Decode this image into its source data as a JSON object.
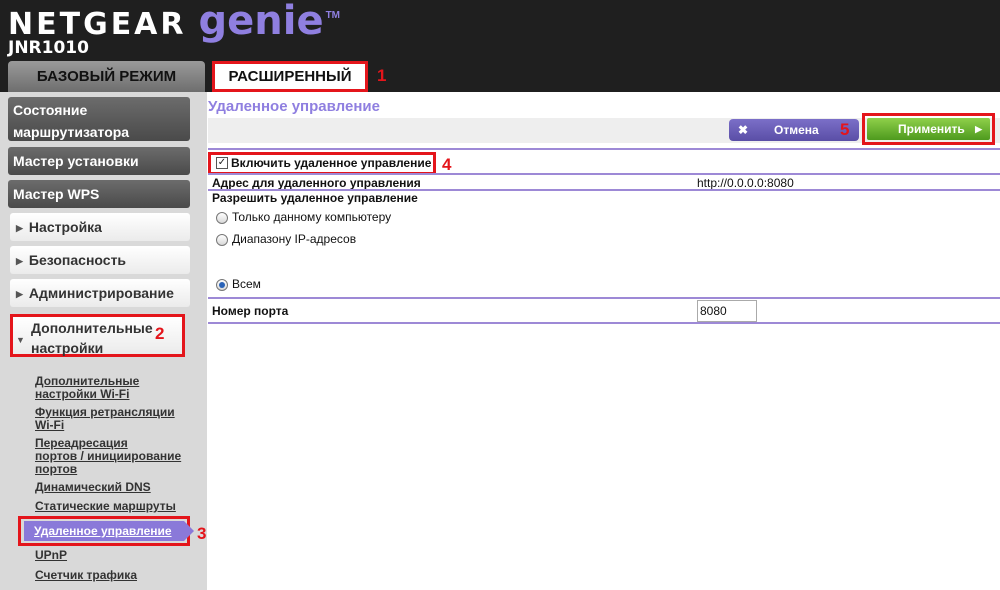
{
  "header": {
    "brand_netgear": "NETGEAR",
    "brand_genie": "genie",
    "brand_tm": "TM",
    "model": "JNR1010"
  },
  "tabs": {
    "basic": "БАЗОВЫЙ РЕЖИМ",
    "advanced": "РАСШИРЕННЫЙ"
  },
  "annotations": [
    "1",
    "2",
    "3",
    "4",
    "5"
  ],
  "sidebar": {
    "router_status_line1": "Состояние",
    "router_status_line2": "маршрутизатора",
    "setup_wizard": "Мастер установки",
    "wps_wizard": "Мастер WPS",
    "setup": "Настройка",
    "security": "Безопасность",
    "administration": "Администрирование",
    "advanced_setup_line1": "Дополнительные",
    "advanced_setup_line2": "настройки",
    "sub_items": {
      "wireless_settings_line1": "Дополнительные",
      "wireless_settings_line2": "настройки Wi-Fi",
      "wifi_repeater_line1": "Функция ретрансляции",
      "wifi_repeater_line2": "Wi-Fi",
      "port_forwarding_line1": "Переадресация",
      "port_forwarding_line2": "портов / инициирование",
      "port_forwarding_line3": "портов",
      "dynamic_dns": "Динамический DNS",
      "static_routes": "Статические маршруты",
      "remote_management": "Удаленное управление",
      "upnp": "UPnP",
      "traffic_meter": "Счетчик трафика"
    }
  },
  "main": {
    "page_title": "Удаленное управление",
    "cancel_label": "Отмена",
    "apply_label": "Применить",
    "enable_remote_label": "Включить удаленное управление",
    "enable_remote_checked": true,
    "address_label": "Адрес для удаленного управления",
    "address_value": "http://0.0.0.0:8080",
    "allow_label": "Разрешить удаленное управление",
    "option_single_pc": "Только данному компьютеру",
    "option_ip_range": "Диапазону IP-адресов",
    "option_everyone": "Всем",
    "selected_option": "Всем",
    "port_label": "Номер порта",
    "port_value": "8080"
  },
  "colors": {
    "header_bg": "#1f1f1f",
    "accent_purple": "#8f7fe0",
    "highlight_red": "#e4151b",
    "apply_green": "#5aa82a"
  }
}
